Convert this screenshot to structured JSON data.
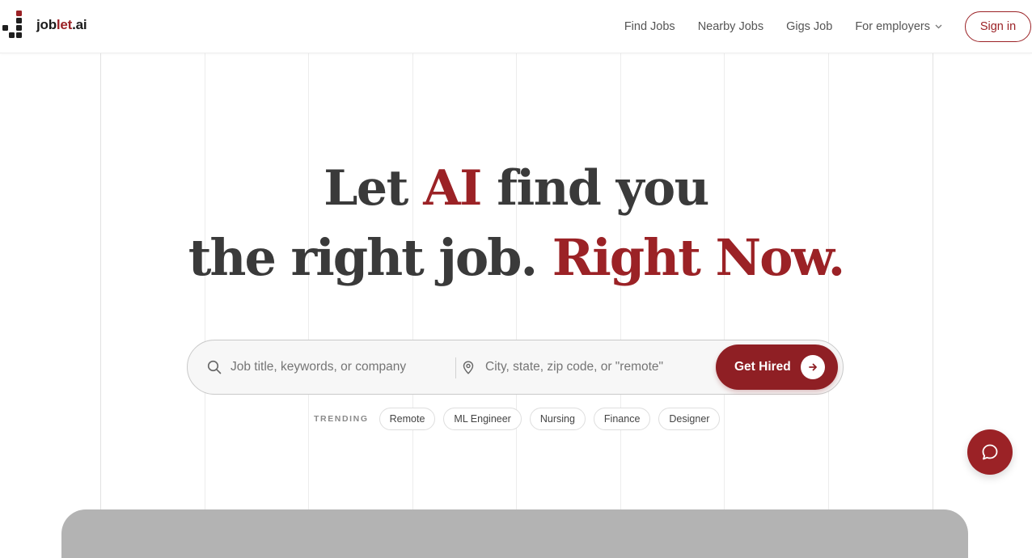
{
  "brand": {
    "name_prefix": "job",
    "name_accent": "let",
    "name_suffix": ".ai",
    "accent_color": "#9b2226"
  },
  "nav": {
    "links": [
      "Find Jobs",
      "Nearby Jobs",
      "Gigs Job",
      "For employers"
    ],
    "dropdown_icon": "chevron-down-icon",
    "signin_label": "Sign in"
  },
  "hero": {
    "line1_a": "Let ",
    "line1_b": "AI",
    "line1_c": " find you",
    "line2_a": "the right job. ",
    "line2_b": "Right Now."
  },
  "search": {
    "query_placeholder": "Job title, keywords, or company",
    "location_placeholder": "City, state, zip code, or \"remote\"",
    "submit_label": "Get Hired"
  },
  "trending": {
    "label": "TRENDING",
    "chips": [
      "Remote",
      "ML Engineer",
      "Nursing",
      "Finance",
      "Designer"
    ]
  },
  "chat": {
    "icon": "chat-bubble-icon"
  }
}
